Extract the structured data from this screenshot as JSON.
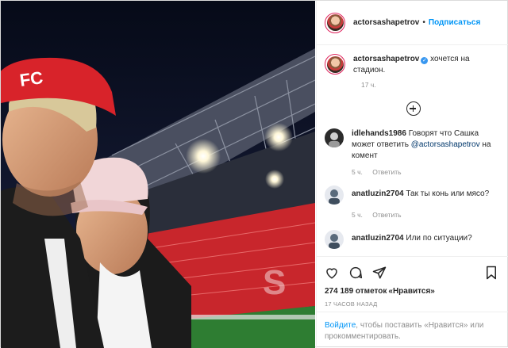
{
  "header": {
    "username": "actorsashapetrov",
    "separator": "•",
    "follow_label": "Подписаться"
  },
  "caption": {
    "username": "actorsashapetrov",
    "text": "хочется на стадион.",
    "time": "17 ч."
  },
  "load_more_icon": "plus-circle-icon",
  "comments": [
    {
      "username": "idlehands1986",
      "text_before": "Говорят что Сашка может ответить",
      "mention": "@actorsashapetrov",
      "text_after": "на комент",
      "time": "5 ч.",
      "reply_label": "Ответить"
    },
    {
      "username": "anatluzin2704",
      "text": "Так ты конь или мясо?",
      "time": "5 ч.",
      "reply_label": "Ответить"
    },
    {
      "username": "anatluzin2704",
      "text": "Или по ситуации?"
    }
  ],
  "actions": {
    "icons": [
      "heart-icon",
      "comment-icon",
      "share-icon",
      "bookmark-icon"
    ],
    "likes_count": "274 189 отметок",
    "likes_suffix": "«Нравится»",
    "date": "17 ЧАСОВ НАЗАД"
  },
  "login_prompt": {
    "link": "Войдите",
    "text": ", чтобы поставить «Нравится» или прокомментировать."
  },
  "photo": {
    "cap_text": "FC",
    "stand_letter": "S"
  },
  "colors": {
    "follow": "#0095f6",
    "verified": "#3897f0",
    "stadium_red": "#c8262c",
    "cap_red": "#d8232a"
  }
}
